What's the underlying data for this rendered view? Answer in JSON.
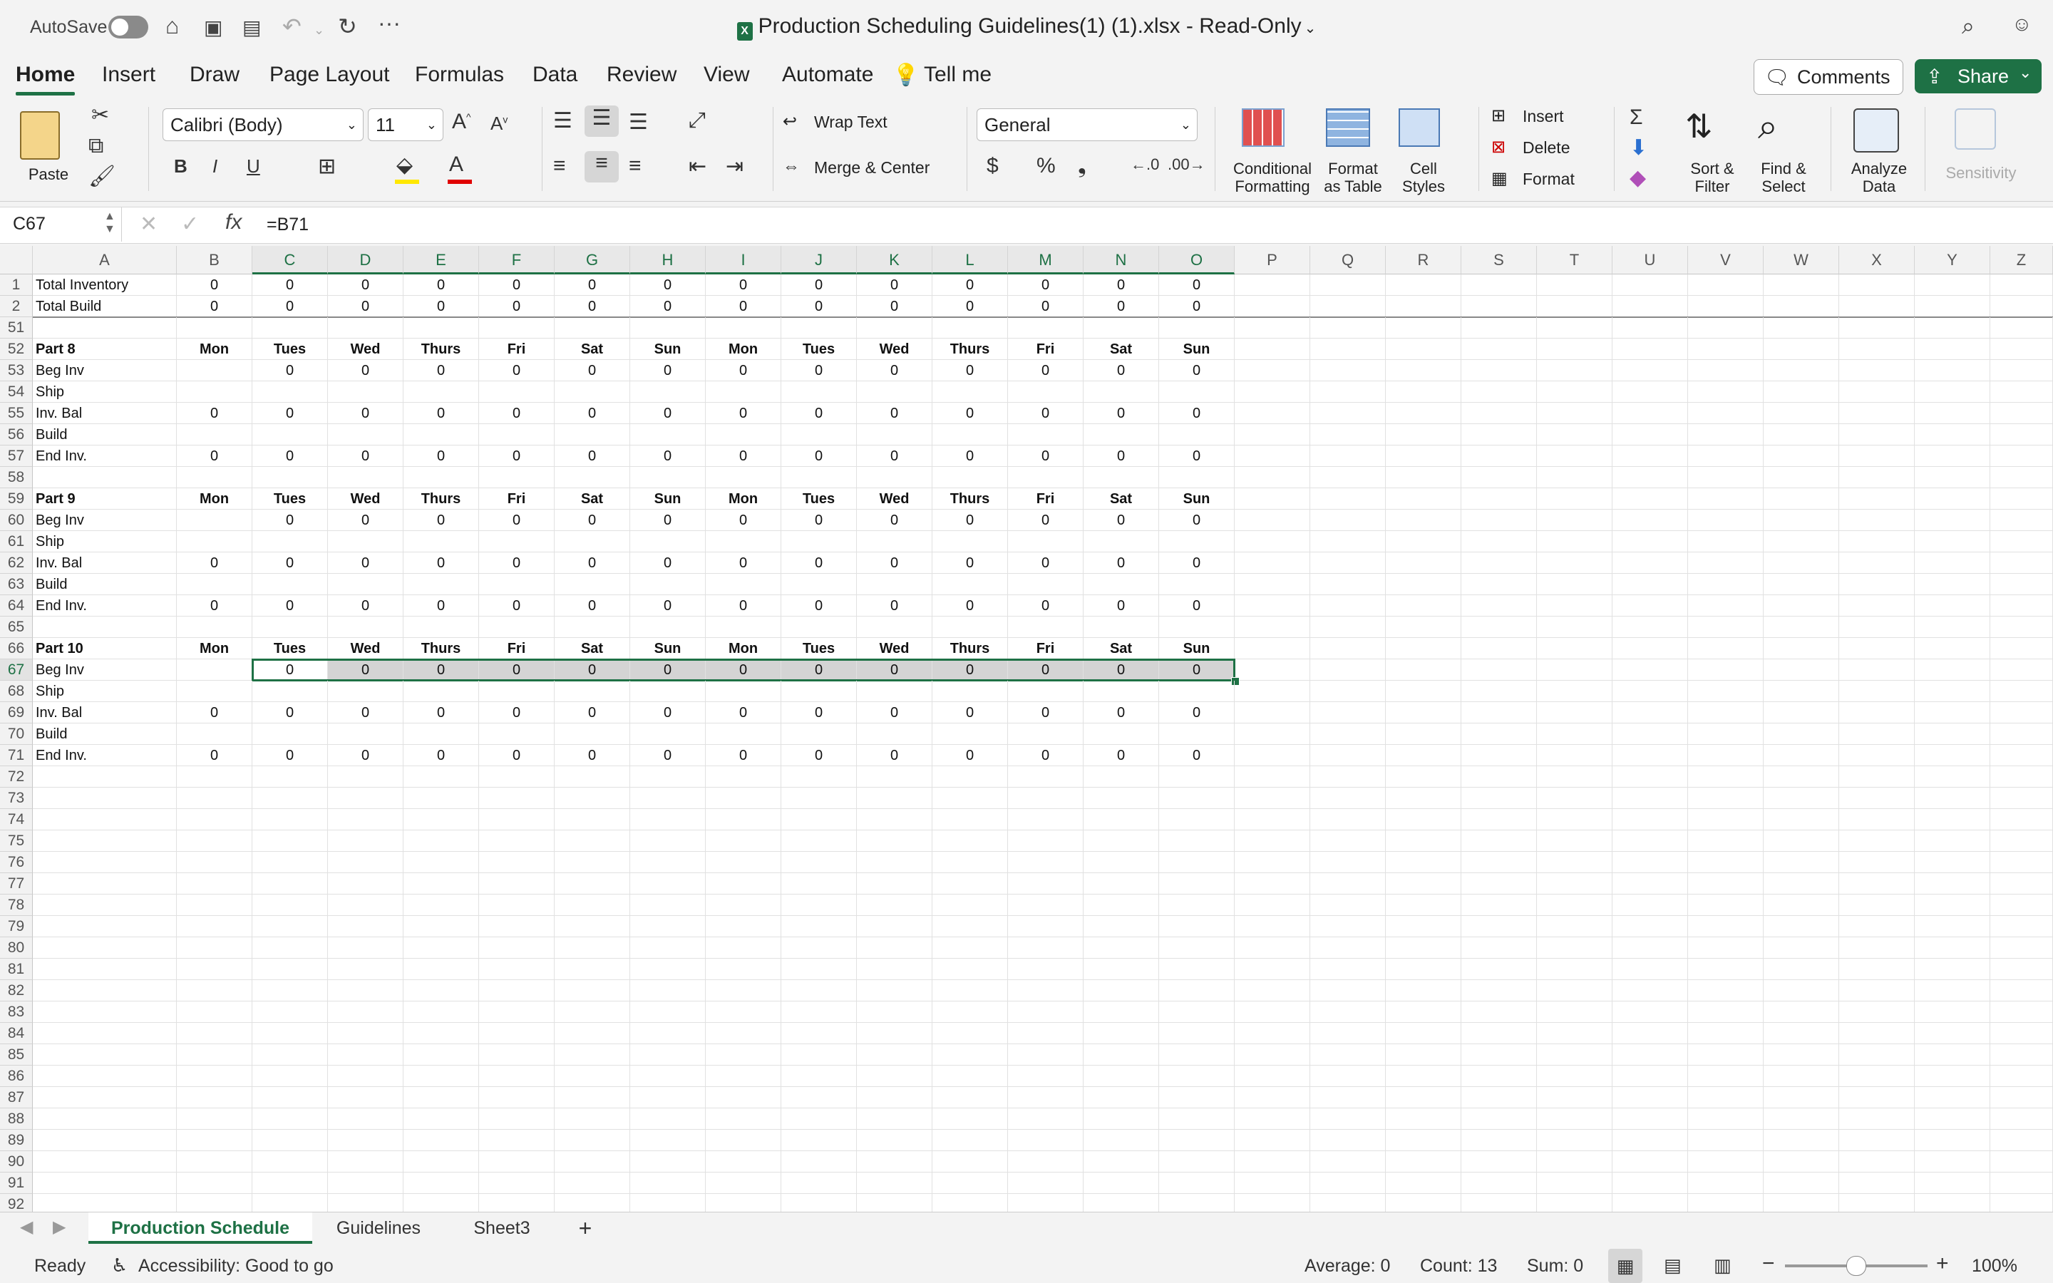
{
  "titlebar": {
    "autosave_label": "AutoSave",
    "file_title": "Production Scheduling Guidelines(1) (1).xlsx  -  Read-Only",
    "more_glyph": "···"
  },
  "ribbon_tabs": [
    "Home",
    "Insert",
    "Draw",
    "Page Layout",
    "Formulas",
    "Data",
    "Review",
    "View",
    "Automate"
  ],
  "tell_me": "Tell me",
  "comments_label": "Comments",
  "share_label": "Share",
  "ribbon": {
    "paste": "Paste",
    "font_name": "Calibri (Body)",
    "font_size": "11",
    "bold": "B",
    "italic": "I",
    "underline": "U",
    "wrap_text": "Wrap Text",
    "merge_center": "Merge & Center",
    "number_format": "General",
    "currency": "$",
    "percent": "%",
    "comma": "❟",
    "conditional_formatting": [
      "Conditional",
      "Formatting"
    ],
    "format_as_table": [
      "Format",
      "as Table"
    ],
    "cell_styles": [
      "Cell",
      "Styles"
    ],
    "insert": "Insert",
    "delete": "Delete",
    "format": "Format",
    "sort_filter": [
      "Sort &",
      "Filter"
    ],
    "find_select": [
      "Find &",
      "Select"
    ],
    "analyze_data": [
      "Analyze",
      "Data"
    ],
    "sensitivity": "Sensitivity",
    "accent": "#1e7145"
  },
  "formula_bar": {
    "name_box": "C67",
    "fx": "fx",
    "formula": "=B71"
  },
  "columns": [
    "A",
    "B",
    "C",
    "D",
    "E",
    "F",
    "G",
    "H",
    "I",
    "J",
    "K",
    "L",
    "M",
    "N",
    "O",
    "P",
    "Q",
    "R",
    "S",
    "T",
    "U",
    "V",
    "W",
    "X",
    "Y",
    "Z"
  ],
  "rows": [
    {
      "n": "1",
      "cells": [
        "Total Inventory",
        "0",
        "0",
        "0",
        "0",
        "0",
        "0",
        "0",
        "0",
        "0",
        "0",
        "0",
        "0",
        "0",
        "0"
      ]
    },
    {
      "n": "2",
      "cells": [
        "Total Build",
        "0",
        "0",
        "0",
        "0",
        "0",
        "0",
        "0",
        "0",
        "0",
        "0",
        "0",
        "0",
        "0",
        "0"
      ]
    },
    {
      "n": "51",
      "cells": []
    },
    {
      "n": "52",
      "bold": true,
      "cells": [
        "Part 8",
        "Mon",
        "Tues",
        "Wed",
        "Thurs",
        "Fri",
        "Sat",
        "Sun",
        "Mon",
        "Tues",
        "Wed",
        "Thurs",
        "Fri",
        "Sat",
        "Sun"
      ]
    },
    {
      "n": "53",
      "cells": [
        "Beg Inv",
        "",
        "0",
        "0",
        "0",
        "0",
        "0",
        "0",
        "0",
        "0",
        "0",
        "0",
        "0",
        "0",
        "0"
      ]
    },
    {
      "n": "54",
      "cells": [
        "Ship"
      ]
    },
    {
      "n": "55",
      "cells": [
        "Inv. Bal",
        "0",
        "0",
        "0",
        "0",
        "0",
        "0",
        "0",
        "0",
        "0",
        "0",
        "0",
        "0",
        "0",
        "0"
      ]
    },
    {
      "n": "56",
      "cells": [
        "Build"
      ]
    },
    {
      "n": "57",
      "cells": [
        "End Inv.",
        "0",
        "0",
        "0",
        "0",
        "0",
        "0",
        "0",
        "0",
        "0",
        "0",
        "0",
        "0",
        "0",
        "0"
      ]
    },
    {
      "n": "58",
      "cells": []
    },
    {
      "n": "59",
      "bold": true,
      "cells": [
        "Part 9",
        "Mon",
        "Tues",
        "Wed",
        "Thurs",
        "Fri",
        "Sat",
        "Sun",
        "Mon",
        "Tues",
        "Wed",
        "Thurs",
        "Fri",
        "Sat",
        "Sun"
      ]
    },
    {
      "n": "60",
      "cells": [
        "Beg Inv",
        "",
        "0",
        "0",
        "0",
        "0",
        "0",
        "0",
        "0",
        "0",
        "0",
        "0",
        "0",
        "0",
        "0"
      ]
    },
    {
      "n": "61",
      "cells": [
        "Ship"
      ]
    },
    {
      "n": "62",
      "cells": [
        "Inv. Bal",
        "0",
        "0",
        "0",
        "0",
        "0",
        "0",
        "0",
        "0",
        "0",
        "0",
        "0",
        "0",
        "0",
        "0"
      ]
    },
    {
      "n": "63",
      "cells": [
        "Build"
      ]
    },
    {
      "n": "64",
      "cells": [
        "End Inv.",
        "0",
        "0",
        "0",
        "0",
        "0",
        "0",
        "0",
        "0",
        "0",
        "0",
        "0",
        "0",
        "0",
        "0"
      ]
    },
    {
      "n": "65",
      "cells": []
    },
    {
      "n": "66",
      "bold": true,
      "cells": [
        "Part 10",
        "Mon",
        "Tues",
        "Wed",
        "Thurs",
        "Fri",
        "Sat",
        "Sun",
        "Mon",
        "Tues",
        "Wed",
        "Thurs",
        "Fri",
        "Sat",
        "Sun"
      ]
    },
    {
      "n": "67",
      "selected": true,
      "cells": [
        "Beg Inv",
        "",
        "0",
        "0",
        "0",
        "0",
        "0",
        "0",
        "0",
        "0",
        "0",
        "0",
        "0",
        "0",
        "0"
      ]
    },
    {
      "n": "68",
      "cells": [
        "Ship"
      ]
    },
    {
      "n": "69",
      "cells": [
        "Inv. Bal",
        "0",
        "0",
        "0",
        "0",
        "0",
        "0",
        "0",
        "0",
        "0",
        "0",
        "0",
        "0",
        "0",
        "0"
      ]
    },
    {
      "n": "70",
      "cells": [
        "Build"
      ]
    },
    {
      "n": "71",
      "cells": [
        "End Inv.",
        "0",
        "0",
        "0",
        "0",
        "0",
        "0",
        "0",
        "0",
        "0",
        "0",
        "0",
        "0",
        "0",
        "0"
      ]
    },
    {
      "n": "72",
      "cells": []
    },
    {
      "n": "73",
      "cells": []
    },
    {
      "n": "74",
      "cells": []
    },
    {
      "n": "75",
      "cells": []
    },
    {
      "n": "76",
      "cells": []
    },
    {
      "n": "77",
      "cells": []
    },
    {
      "n": "78",
      "cells": []
    },
    {
      "n": "79",
      "cells": []
    },
    {
      "n": "80",
      "cells": []
    },
    {
      "n": "81",
      "cells": []
    },
    {
      "n": "82",
      "cells": []
    },
    {
      "n": "83",
      "cells": []
    },
    {
      "n": "84",
      "cells": []
    },
    {
      "n": "85",
      "cells": []
    },
    {
      "n": "86",
      "cells": []
    },
    {
      "n": "87",
      "cells": []
    },
    {
      "n": "88",
      "cells": []
    },
    {
      "n": "89",
      "cells": []
    },
    {
      "n": "90",
      "cells": []
    },
    {
      "n": "91",
      "cells": []
    },
    {
      "n": "92",
      "cells": []
    }
  ],
  "sheet_tabs": [
    "Production Schedule",
    "Guidelines",
    "Sheet3"
  ],
  "add_sheet": "+",
  "status": {
    "ready": "Ready",
    "accessibility": "Accessibility: Good to go",
    "average": "Average: 0",
    "count": "Count: 13",
    "sum": "Sum: 0",
    "zoom": "100%"
  }
}
